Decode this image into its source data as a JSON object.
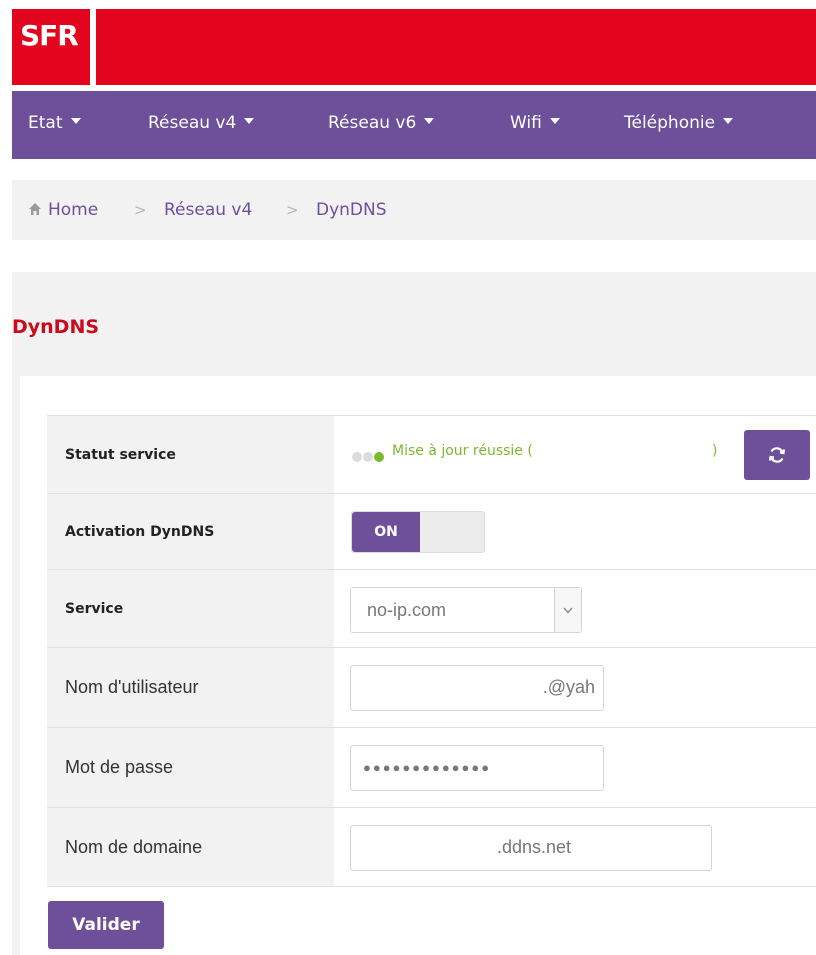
{
  "brand": {
    "logo_text": "SFR",
    "color": "#e2051d"
  },
  "nav": {
    "items": [
      {
        "label": "Etat"
      },
      {
        "label": "Réseau v4"
      },
      {
        "label": "Réseau v6"
      },
      {
        "label": "Wifi"
      },
      {
        "label": "Téléphonie"
      }
    ]
  },
  "breadcrumb": {
    "items": [
      "Home",
      "Réseau v4",
      "DynDNS"
    ],
    "separator": ">"
  },
  "page": {
    "title": "DynDNS"
  },
  "form": {
    "status": {
      "label": "Statut service",
      "text": "Mise à jour réussie (",
      "text_close": ")",
      "icon": "refresh-icon"
    },
    "activation": {
      "label": "Activation DynDNS",
      "state": "ON"
    },
    "service": {
      "label": "Service",
      "value": "no-ip.com"
    },
    "username": {
      "label": "Nom d'utilisateur",
      "value": ".@yah"
    },
    "password": {
      "label": "Mot de passe",
      "value": "●●●●●●●●●●●●●"
    },
    "domain": {
      "label": "Nom de domaine",
      "value": ".ddns.net"
    },
    "submit_label": "Valider"
  },
  "colors": {
    "accent": "#6e4f9a",
    "title": "#cc0a1e",
    "success": "#7cb82f"
  }
}
